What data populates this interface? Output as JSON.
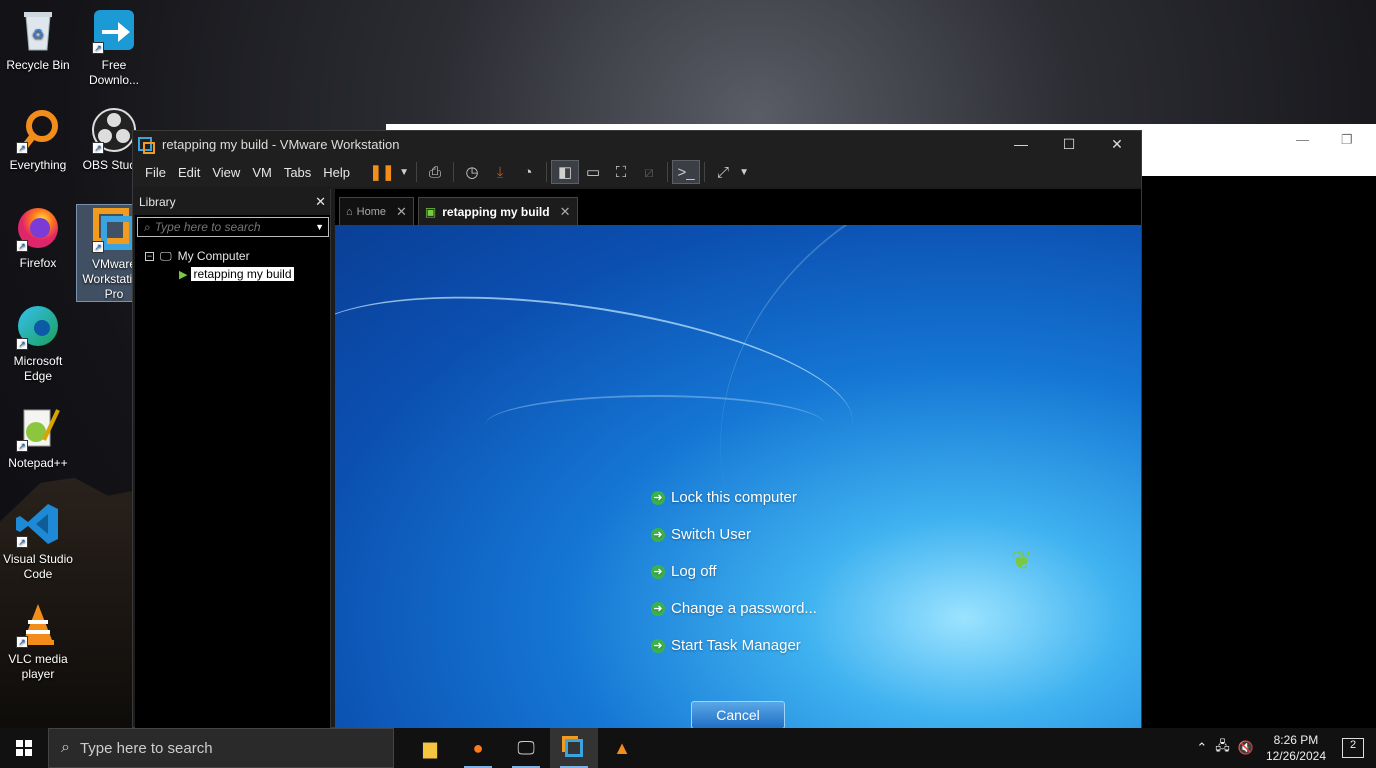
{
  "desktop": {
    "icons": [
      {
        "label": "Recycle Bin",
        "icon": "recycle-bin-icon"
      },
      {
        "label": "Free Downlo...",
        "icon": "download-icon"
      },
      {
        "label": "Everything",
        "icon": "magnifier-icon"
      },
      {
        "label": "OBS Studio",
        "icon": "obs-icon"
      },
      {
        "label": "Firefox",
        "icon": "firefox-icon"
      },
      {
        "label": "VMware Workstation Pro",
        "icon": "vmware-icon"
      },
      {
        "label": "Microsoft Edge",
        "icon": "edge-icon"
      },
      {
        "label": "Notepad++",
        "icon": "notepad-icon"
      },
      {
        "label": "Visual Studio Code",
        "icon": "vscode-icon"
      },
      {
        "label": "VLC media player",
        "icon": "vlc-icon"
      }
    ]
  },
  "vmware": {
    "title": "retapping my build - VMware Workstation",
    "menu": [
      "File",
      "Edit",
      "View",
      "VM",
      "Tabs",
      "Help"
    ],
    "library": {
      "title": "Library",
      "search_placeholder": "Type here to search",
      "tree_root": "My Computer",
      "tree_vm": "retapping my build"
    },
    "tabs": [
      {
        "label": "Home"
      },
      {
        "label": "retapping my build"
      }
    ]
  },
  "guest": {
    "options": [
      "Lock this computer",
      "Switch User",
      "Log off",
      "Change a password...",
      "Start Task Manager"
    ],
    "cancel": "Cancel"
  },
  "taskbar": {
    "search_placeholder": "Type here to search",
    "time": "8:26 PM",
    "date": "12/26/2024",
    "notification_count": "2"
  },
  "colors": {
    "accent_orange": "#f29c1f",
    "accent_blue": "#3aa3e0",
    "guest_bg": "#1576d4"
  }
}
